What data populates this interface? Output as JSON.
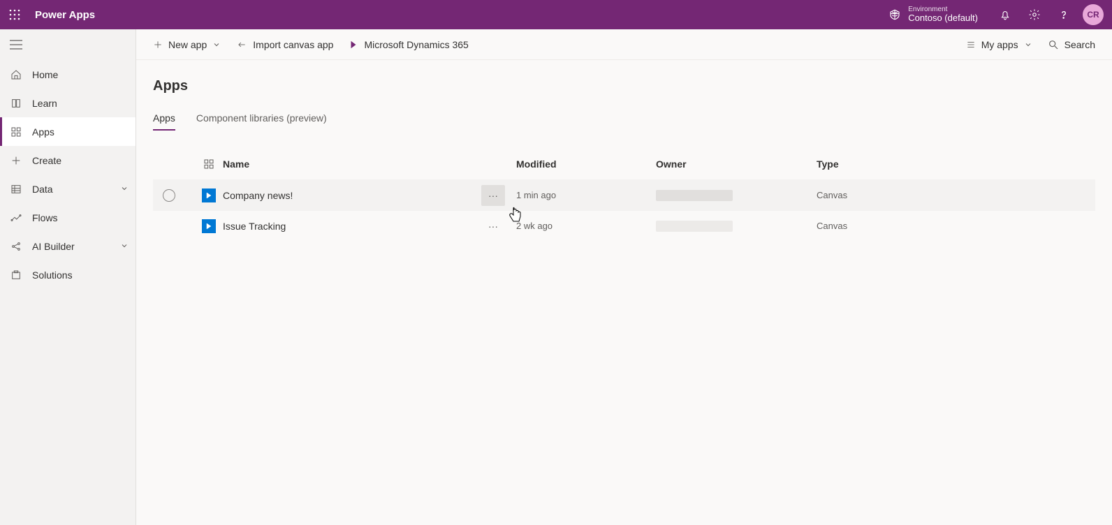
{
  "header": {
    "brand": "Power Apps",
    "environment_label": "Environment",
    "environment_name": "Contoso (default)",
    "avatar_initials": "CR"
  },
  "sidebar": {
    "items": [
      {
        "label": "Home"
      },
      {
        "label": "Learn"
      },
      {
        "label": "Apps"
      },
      {
        "label": "Create"
      },
      {
        "label": "Data"
      },
      {
        "label": "Flows"
      },
      {
        "label": "AI Builder"
      },
      {
        "label": "Solutions"
      }
    ]
  },
  "commandbar": {
    "new_app": "New app",
    "import_canvas": "Import canvas app",
    "dynamics": "Microsoft Dynamics 365",
    "filter": "My apps",
    "search_placeholder": "Search"
  },
  "page": {
    "title": "Apps",
    "tabs": [
      {
        "label": "Apps"
      },
      {
        "label": "Component libraries (preview)"
      }
    ]
  },
  "table": {
    "headers": {
      "name": "Name",
      "modified": "Modified",
      "owner": "Owner",
      "type": "Type"
    },
    "rows": [
      {
        "name": "Company news!",
        "modified": "1 min ago",
        "type": "Canvas"
      },
      {
        "name": "Issue Tracking",
        "modified": "2 wk ago",
        "type": "Canvas"
      }
    ]
  }
}
